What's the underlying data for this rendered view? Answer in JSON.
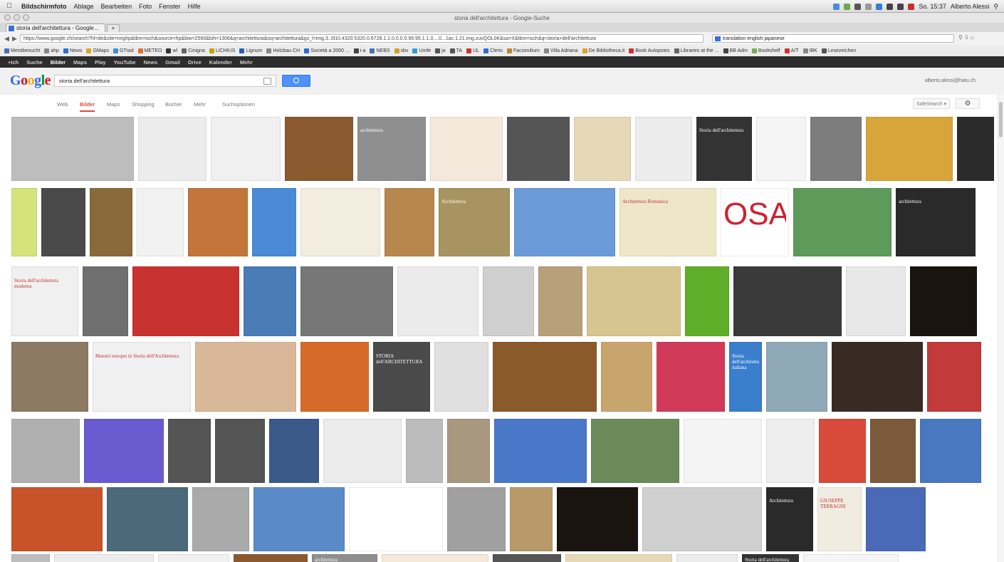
{
  "menubar": {
    "app_name": "Bildschirmfoto",
    "items": [
      "Ablage",
      "Bearbeiten",
      "Foto",
      "Fenster",
      "Hilfe"
    ],
    "clock": "So. 15:37",
    "user": "Alberto Alessi"
  },
  "window": {
    "title": "storia dell'architettura - Google-Suche"
  },
  "tab": {
    "label": "storia dell'architettura - Google..."
  },
  "address": {
    "url": "https://www.google.ch/search?hl=de&site=imghp&tbm=isch&source=hp&biw=2560&bih=1306&q=architettura&oq=architettura&gs_l=img.3..0l10.4320.5320.0.6728.1.1.0.0.0.0.95.95.1.1.0....0...1ac.1.21.img.zuvQOL0K&sa=X&tbm=isch&q=storia+dell'architettura",
    "search_box": "translation english japanese"
  },
  "bookmarks": [
    {
      "label": "Meistbesucht",
      "color": "#4a6fb5"
    },
    {
      "label": "ahp",
      "color": "#888"
    },
    {
      "label": "News",
      "color": "#2b6fd1"
    },
    {
      "label": "GMaps",
      "color": "#e0a32b"
    },
    {
      "label": "GTrad",
      "color": "#3b8fd8"
    },
    {
      "label": "METEO",
      "color": "#e0722b"
    },
    {
      "label": "wl",
      "color": "#333"
    },
    {
      "label": "Cinigna",
      "color": "#666"
    },
    {
      "label": "LICHIUS",
      "color": "#c8a000"
    },
    {
      "label": "Lignum",
      "color": "#2b5fb5"
    },
    {
      "label": "Holzbau CH",
      "color": "#888"
    },
    {
      "label": "Società a 2000 ...",
      "color": "#2b6fd1"
    },
    {
      "label": "i-a",
      "color": "#444"
    },
    {
      "label": "NEBS",
      "color": "#4a6fb5"
    },
    {
      "label": "sbv",
      "color": "#d1a02b"
    },
    {
      "label": "Umfe",
      "color": "#2b9fd1"
    },
    {
      "label": "ja",
      "color": "#555"
    },
    {
      "label": "TA",
      "color": "#555"
    },
    {
      "label": "UL",
      "color": "#c33"
    },
    {
      "label": "Cleris",
      "color": "#2b6fd1"
    },
    {
      "label": "Facsimilium",
      "color": "#b83"
    },
    {
      "label": "Villa Adriana",
      "color": "#888"
    },
    {
      "label": "De Bibliotheca.it",
      "color": "#e0a32b"
    },
    {
      "label": "Book Autopsies",
      "color": "#c33"
    },
    {
      "label": "Libraries at the ...",
      "color": "#666"
    },
    {
      "label": "BB Adm",
      "color": "#444"
    },
    {
      "label": "Bookshelf",
      "color": "#7a5"
    },
    {
      "label": "A/T",
      "color": "#c33"
    },
    {
      "label": "IBK",
      "color": "#888"
    },
    {
      "label": "Lesezeichen",
      "color": "#555"
    }
  ],
  "google_bar": {
    "items": [
      "+Ich",
      "Suche",
      "Bilder",
      "Maps",
      "Play",
      "YouTube",
      "News",
      "Gmail",
      "Drive",
      "Kalender",
      "Mehr"
    ],
    "active": "Bilder"
  },
  "search": {
    "logo": {
      "G": "G",
      "o1": "o",
      "o2": "o",
      "g": "g",
      "l": "l",
      "e": "e"
    },
    "query": "storia dell'architettura",
    "account": "alberto.alessi@hatu.ch"
  },
  "modes": {
    "items": [
      "Web",
      "Bilder",
      "Maps",
      "Shopping",
      "Bücher",
      "Mehr",
      "Suchoptionen"
    ],
    "safesearch_label": "SafeSearch"
  },
  "images": [
    {
      "label": "",
      "color": "#bdbdbd",
      "text": ""
    },
    {
      "label": "",
      "color": "#ececec",
      "text": ""
    },
    {
      "label": "",
      "color": "#f0f0f0",
      "text": ""
    },
    {
      "label": "",
      "color": "#8a5a2e",
      "text": ""
    },
    {
      "label": "",
      "color": "#8f8f8f",
      "text": "architettura"
    },
    {
      "label": "",
      "color": "#f3e8da",
      "text": ""
    },
    {
      "label": "",
      "color": "#555",
      "text": ""
    },
    {
      "label": "",
      "color": "#e6d9b8",
      "text": ""
    },
    {
      "label": "",
      "color": "#ececec",
      "text": ""
    },
    {
      "label": "",
      "color": "#333",
      "text": "Storia dell'architettura"
    },
    {
      "label": "",
      "color": "#f5f5f5",
      "text": ""
    },
    {
      "label": "",
      "color": "#7d7d7d",
      "text": ""
    },
    {
      "label": "",
      "color": "#d8a53a",
      "text": ""
    },
    {
      "label": "",
      "color": "#2b2b2b",
      "text": ""
    },
    {
      "label": "",
      "color": "#d4e37a",
      "text": ""
    },
    {
      "label": "",
      "color": "#4a4a4a",
      "text": ""
    },
    {
      "label": "",
      "color": "#8a6a3a",
      "text": ""
    },
    {
      "label": "",
      "color": "#f2f2f2",
      "text": ""
    },
    {
      "label": "",
      "color": "#c4753a",
      "text": ""
    },
    {
      "label": "",
      "color": "#4a8ad6",
      "text": ""
    },
    {
      "label": "",
      "color": "#f3ede0",
      "text": ""
    },
    {
      "label": "",
      "color": "#b8874e",
      "text": ""
    },
    {
      "label": "",
      "color": "#a89460",
      "text": "Architettura"
    },
    {
      "label": "",
      "color": "#6b9bd8",
      "text": ""
    },
    {
      "label": "",
      "color": "#ede7c8",
      "text": "Architettura Romanica"
    },
    {
      "label": "",
      "color": "#ffffff",
      "text": "OSA"
    },
    {
      "label": "",
      "color": "#5e9a5a",
      "text": ""
    },
    {
      "label": "",
      "color": "#2a2a2a",
      "text": "architettura"
    },
    {
      "label": "",
      "color": "#f0f0f0",
      "text": "Storia dell'architettura moderna"
    },
    {
      "label": "",
      "color": "#6f6f6f",
      "text": ""
    },
    {
      "label": "",
      "color": "#c83230",
      "text": ""
    },
    {
      "label": "",
      "color": "#4a7cb8",
      "text": ""
    },
    {
      "label": "",
      "color": "#777",
      "text": ""
    },
    {
      "label": "",
      "color": "#ebebeb",
      "text": ""
    },
    {
      "label": "",
      "color": "#cfcfcf",
      "text": ""
    },
    {
      "label": "",
      "color": "#b8a07a",
      "text": ""
    },
    {
      "label": "",
      "color": "#d6c58e",
      "text": ""
    },
    {
      "label": "",
      "color": "#5fae2a",
      "text": ""
    },
    {
      "label": "",
      "color": "#3a3a3a",
      "text": ""
    },
    {
      "label": "",
      "color": "#e8e8e8",
      "text": ""
    },
    {
      "label": "",
      "color": "#1a140e",
      "text": ""
    },
    {
      "label": "",
      "color": "#8c7a64",
      "text": ""
    },
    {
      "label": "",
      "color": "#f0f0f0",
      "text": "Maestri europei in Storia dell'Architettura"
    },
    {
      "label": "",
      "color": "#d9b89a",
      "text": ""
    },
    {
      "label": "",
      "color": "#d66a2a",
      "text": ""
    },
    {
      "label": "",
      "color": "#4a4a4a",
      "text": "STORIA dell'ARCHITETTURA"
    },
    {
      "label": "",
      "color": "#e0e0e0",
      "text": ""
    },
    {
      "label": "",
      "color": "#8b5a2b",
      "text": ""
    },
    {
      "label": "",
      "color": "#c9a56e",
      "text": ""
    },
    {
      "label": "",
      "color": "#d23a5a",
      "text": ""
    },
    {
      "label": "",
      "color": "#3a7ecc",
      "text": "Storia dell'architettura italiana"
    },
    {
      "label": "",
      "color": "#8fa8b8",
      "text": ""
    },
    {
      "label": "",
      "color": "#3a2a24",
      "text": ""
    },
    {
      "label": "",
      "color": "#c23a3a",
      "text": ""
    },
    {
      "label": "",
      "color": "#b0b0b0",
      "text": ""
    },
    {
      "label": "",
      "color": "#6a5ad0",
      "text": ""
    },
    {
      "label": "",
      "color": "#555",
      "text": ""
    },
    {
      "label": "",
      "color": "#555",
      "text": ""
    },
    {
      "label": "",
      "color": "#3a5a8a",
      "text": ""
    },
    {
      "label": "",
      "color": "#ececec",
      "text": ""
    },
    {
      "label": "",
      "color": "#bcbcbc",
      "text": ""
    },
    {
      "label": "",
      "color": "#a89880",
      "text": ""
    },
    {
      "label": "",
      "color": "#4a78c8",
      "text": ""
    },
    {
      "label": "",
      "color": "#6a8a5a",
      "text": ""
    },
    {
      "label": "",
      "color": "#f4f4f4",
      "text": ""
    },
    {
      "label": "",
      "color": "#eeeeee",
      "text": ""
    },
    {
      "label": "",
      "color": "#d84a3a",
      "text": ""
    },
    {
      "label": "",
      "color": "#7a5a3a",
      "text": ""
    },
    {
      "label": "",
      "color": "#4a78c0",
      "text": ""
    },
    {
      "label": "",
      "color": "#c8522a",
      "text": ""
    },
    {
      "label": "",
      "color": "#4a6a7a",
      "text": ""
    },
    {
      "label": "",
      "color": "#aaaaaa",
      "text": ""
    },
    {
      "label": "",
      "color": "#5a8ac8",
      "text": ""
    },
    {
      "label": "",
      "color": "#ffffff",
      "text": ""
    },
    {
      "label": "",
      "color": "#a0a0a0",
      "text": ""
    },
    {
      "label": "",
      "color": "#b89a6a",
      "text": ""
    },
    {
      "label": "",
      "color": "#1a1410",
      "text": ""
    },
    {
      "label": "",
      "color": "#d0d0d0",
      "text": ""
    },
    {
      "label": "",
      "color": "#2a2a2a",
      "text": "Architettura"
    },
    {
      "label": "",
      "color": "#f0ece0",
      "text": "GIUSEPPE TERRAGNI"
    },
    {
      "label": "",
      "color": "#4a6ab8",
      "text": ""
    }
  ]
}
